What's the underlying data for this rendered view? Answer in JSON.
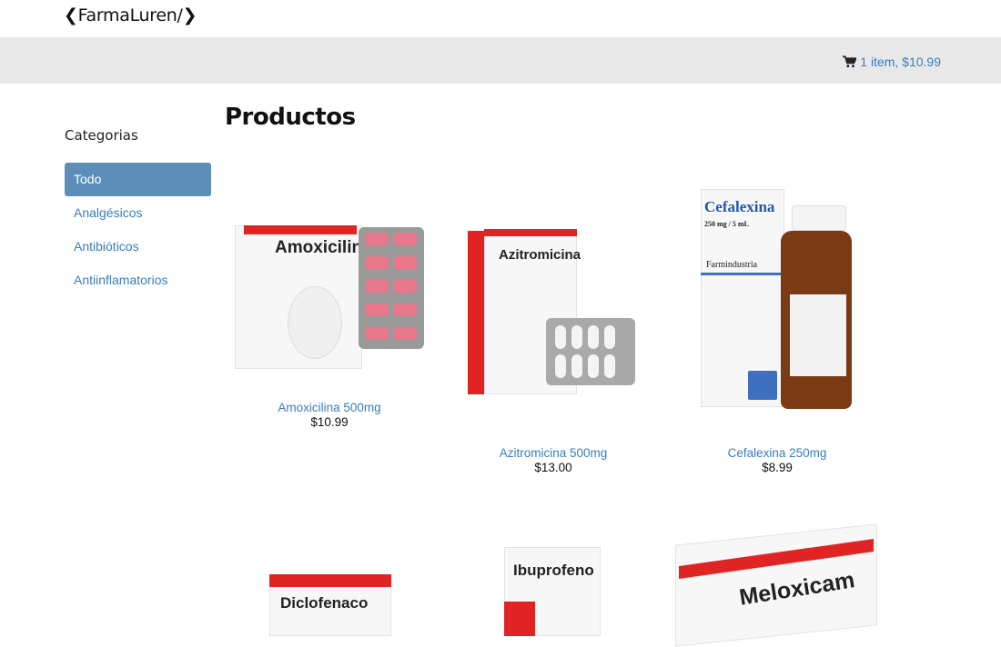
{
  "brand": {
    "prefix": "❮",
    "name": "FarmaLuren/",
    "suffix": "❯"
  },
  "cart": {
    "label": "1 item, $10.99"
  },
  "sidebar": {
    "title": "Categorias",
    "items": [
      {
        "label": "Todo",
        "active": true
      },
      {
        "label": "Analgésicos",
        "active": false
      },
      {
        "label": "Antibióticos",
        "active": false
      },
      {
        "label": "Antiinflamatorios",
        "active": false
      }
    ]
  },
  "main": {
    "title": "Productos",
    "products": [
      {
        "name": "Amoxicilina 500mg",
        "price": "$10.99",
        "box_label": "Amoxicilina"
      },
      {
        "name": "Azitromicina 500mg",
        "price": "$13.00",
        "box_label": "Azitromicina"
      },
      {
        "name": "Cefalexina 250mg",
        "price": "$8.99",
        "box_label": "Cefalexina",
        "box_sub": "250 mg / 5 mL",
        "box_brand": "Farmindustria"
      },
      {
        "name": "Diclofenaco",
        "price": "",
        "box_label": "Diclofenaco"
      },
      {
        "name": "Ibuprofeno",
        "price": "",
        "box_label": "Ibuprofeno"
      },
      {
        "name": "Meloxicam",
        "price": "",
        "box_label": "Meloxicam"
      }
    ]
  },
  "colors": {
    "link": "#3a7dbd",
    "active_bg": "#5b8fba",
    "band": "#e8e8e8",
    "box_red": "#e02424"
  }
}
